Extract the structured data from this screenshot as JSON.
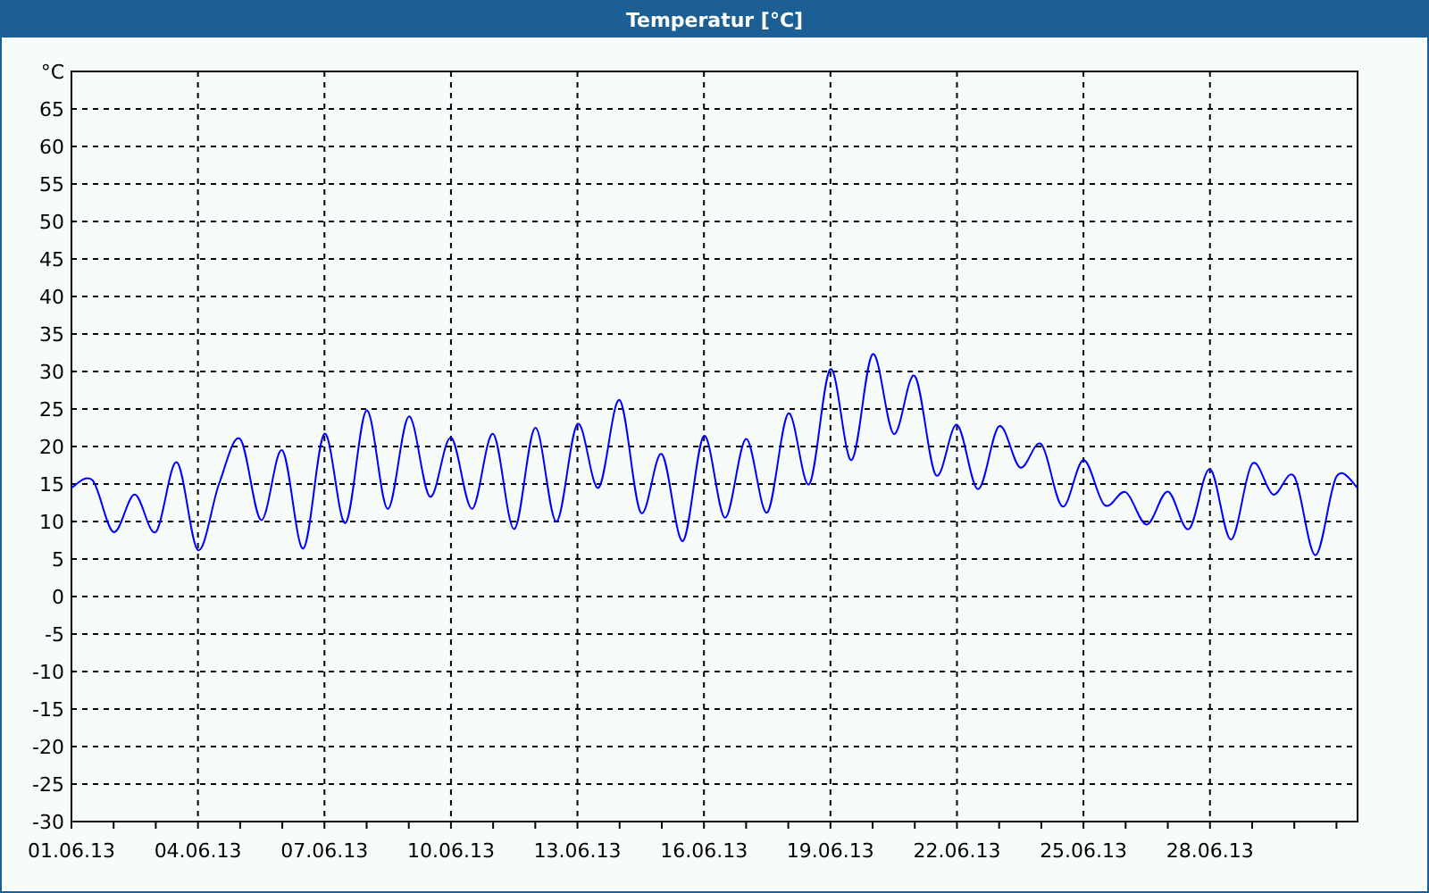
{
  "window": {
    "title": "Temperatur [°C]"
  },
  "chart": {
    "chart_data": {
      "type": "line",
      "grid": true,
      "ylim": [
        -30,
        70
      ],
      "yticks": [
        {
          "value": 70,
          "label": "°C"
        },
        65,
        60,
        55,
        50,
        45,
        40,
        35,
        30,
        25,
        20,
        15,
        10,
        5,
        0,
        -5,
        -10,
        -15,
        -20,
        -25,
        -30
      ],
      "categories": [
        "01.06.13",
        null,
        null,
        null,
        null,
        null,
        "04.06.13",
        null,
        null,
        null,
        null,
        null,
        "07.06.13",
        null,
        null,
        null,
        null,
        null,
        "10.06.13",
        null,
        null,
        null,
        null,
        null,
        "13.06.13",
        null,
        null,
        null,
        null,
        null,
        "16.06.13",
        null,
        null,
        null,
        null,
        null,
        "19.06.13",
        null,
        null,
        null,
        null,
        null,
        "22.06.13",
        null,
        null,
        null,
        null,
        null,
        "25.06.13",
        null,
        null,
        null,
        null,
        null,
        "28.06.13",
        null,
        null,
        null,
        null,
        null,
        null,
        null
      ],
      "series": [
        {
          "color": "#0000ff",
          "values": [
            14.5,
            15.5,
            8.6,
            13.6,
            8.6,
            17.9,
            6.2,
            15,
            21,
            10.2,
            19.5,
            6.4,
            21.7,
            9.8,
            24.8,
            11.7,
            24,
            13.3,
            21.2,
            11.7,
            21.7,
            9,
            22.5,
            10,
            23,
            14.5,
            26.2,
            11.2,
            19,
            7.4,
            21.4,
            10.5,
            21,
            11.2,
            24.4,
            15,
            30.3,
            18.2,
            32.3,
            21.7,
            29.4,
            16.2,
            22.9,
            14.3,
            22.7,
            17.2,
            20.3,
            12,
            18.2,
            12.2,
            13.9,
            9.6,
            14,
            9,
            17,
            7.6,
            17.7,
            13.6,
            16,
            5.5,
            16,
            14.5
          ]
        }
      ]
    }
  }
}
